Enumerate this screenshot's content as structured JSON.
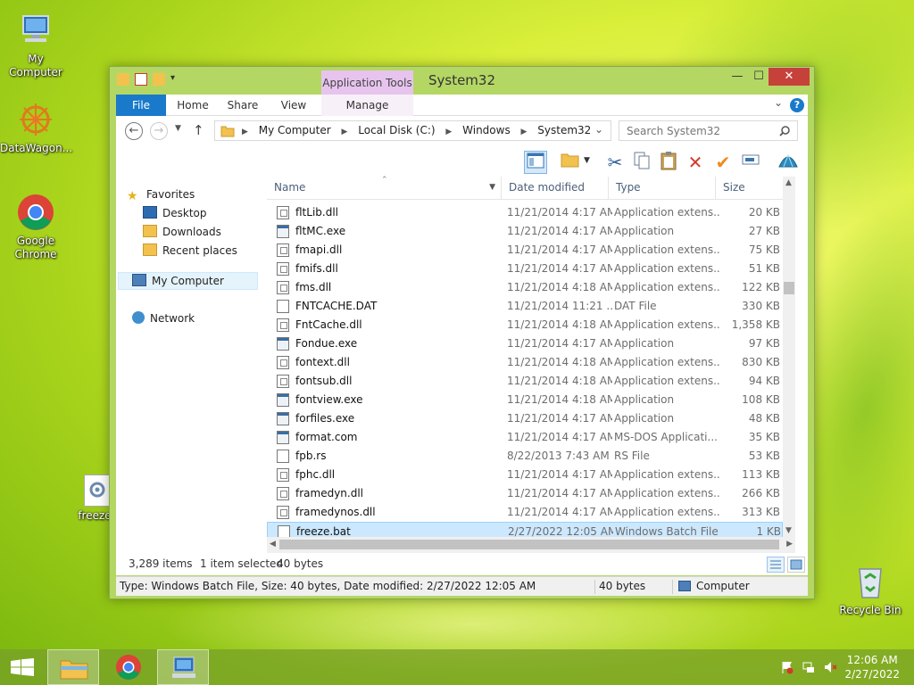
{
  "desktop": {
    "icons": [
      {
        "label": "My Computer",
        "icon": "computer-icon"
      },
      {
        "label": "DataWagon...",
        "icon": "datawagon-icon"
      },
      {
        "label": "Google Chrome",
        "icon": "chrome-icon"
      },
      {
        "label": "freeze",
        "icon": "batch-file-icon"
      },
      {
        "label": "Recycle Bin",
        "icon": "recycle-bin-icon"
      }
    ]
  },
  "window": {
    "title": "System32",
    "minimize": "—",
    "maximize": "☐",
    "close": "✕",
    "contextual_tab_group": "Application Tools",
    "ribbon_tabs": [
      "File",
      "Home",
      "Share",
      "View",
      "Manage"
    ],
    "help": "?",
    "address": {
      "crumbs": [
        "My Computer",
        "Local Disk (C:)",
        "Windows",
        "System32"
      ],
      "placeholder": "Search System32"
    },
    "nav_pane": {
      "favorites": "Favorites",
      "favorites_items": [
        "Desktop",
        "Downloads",
        "Recent places"
      ],
      "computer": "My Computer",
      "network": "Network"
    },
    "columns": {
      "name": "Name",
      "date": "Date modified",
      "type": "Type",
      "size": "Size"
    },
    "files": [
      {
        "name": "fltLib.dll",
        "date": "11/21/2014 4:17 AM",
        "type": "Application extens...",
        "size": "20 KB",
        "kind": "dll"
      },
      {
        "name": "fltMC.exe",
        "date": "11/21/2014 4:17 AM",
        "type": "Application",
        "size": "27 KB",
        "kind": "exe"
      },
      {
        "name": "fmapi.dll",
        "date": "11/21/2014 4:17 AM",
        "type": "Application extens...",
        "size": "75 KB",
        "kind": "dll"
      },
      {
        "name": "fmifs.dll",
        "date": "11/21/2014 4:17 AM",
        "type": "Application extens...",
        "size": "51 KB",
        "kind": "dll"
      },
      {
        "name": "fms.dll",
        "date": "11/21/2014 4:18 AM",
        "type": "Application extens...",
        "size": "122 KB",
        "kind": "dll"
      },
      {
        "name": "FNTCACHE.DAT",
        "date": "11/21/2014 11:21 ...",
        "type": "DAT File",
        "size": "330 KB",
        "kind": "file"
      },
      {
        "name": "FntCache.dll",
        "date": "11/21/2014 4:18 AM",
        "type": "Application extens...",
        "size": "1,358 KB",
        "kind": "dll"
      },
      {
        "name": "Fondue.exe",
        "date": "11/21/2014 4:17 AM",
        "type": "Application",
        "size": "97 KB",
        "kind": "exe"
      },
      {
        "name": "fontext.dll",
        "date": "11/21/2014 4:18 AM",
        "type": "Application extens...",
        "size": "830 KB",
        "kind": "dll"
      },
      {
        "name": "fontsub.dll",
        "date": "11/21/2014 4:18 AM",
        "type": "Application extens...",
        "size": "94 KB",
        "kind": "dll"
      },
      {
        "name": "fontview.exe",
        "date": "11/21/2014 4:18 AM",
        "type": "Application",
        "size": "108 KB",
        "kind": "exe"
      },
      {
        "name": "forfiles.exe",
        "date": "11/21/2014 4:17 AM",
        "type": "Application",
        "size": "48 KB",
        "kind": "exe"
      },
      {
        "name": "format.com",
        "date": "11/21/2014 4:17 AM",
        "type": "MS-DOS Applicati...",
        "size": "35 KB",
        "kind": "exe"
      },
      {
        "name": "fpb.rs",
        "date": "8/22/2013 7:43 AM",
        "type": "RS File",
        "size": "53 KB",
        "kind": "file"
      },
      {
        "name": "fphc.dll",
        "date": "11/21/2014 4:17 AM",
        "type": "Application extens...",
        "size": "113 KB",
        "kind": "dll"
      },
      {
        "name": "framedyn.dll",
        "date": "11/21/2014 4:17 AM",
        "type": "Application extens...",
        "size": "266 KB",
        "kind": "dll"
      },
      {
        "name": "framedynos.dll",
        "date": "11/21/2014 4:17 AM",
        "type": "Application extens...",
        "size": "313 KB",
        "kind": "dll"
      },
      {
        "name": "freeze.bat",
        "date": "2/27/2022 12:05 AM",
        "type": "Windows Batch File",
        "size": "1 KB",
        "kind": "bat",
        "selected": true
      }
    ],
    "status": {
      "items": "3,289 items",
      "selected": "1 item selected",
      "bytes": "40 bytes"
    },
    "details_bar": {
      "info": "Type: Windows Batch File, Size: 40 bytes, Date modified: 2/27/2022 12:05 AM",
      "size": "40 bytes",
      "location": "Computer"
    }
  },
  "taskbar": {
    "time": "12:06 AM",
    "date": "2/27/2022"
  },
  "colors": {
    "accent": "#1979ca",
    "selection": "#cce8ff",
    "window_frame": "#b4d764",
    "close": "#c7413b"
  }
}
